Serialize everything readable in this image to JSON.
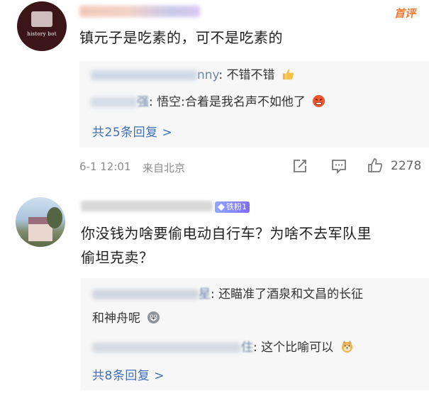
{
  "comment1": {
    "avatar_text": "history bot",
    "badge": "首评",
    "text": "镇元子是吃素的，可不是吃素的",
    "replies": [
      {
        "name_suffix": "nny",
        "text": "不错不错",
        "emoji": "thumbs-up-emoji"
      },
      {
        "name_suffix": "强",
        "text": "悟空:合着是我名声不如他了",
        "emoji": "angry-face-emoji"
      }
    ],
    "more": "共25条回复 >",
    "time": "6-1 12:01",
    "location": "来自北京",
    "likes": "2278"
  },
  "comment2": {
    "fan_badge": "铁粉1",
    "text_line1": "你没钱为啥要偷电动自行车？为啥不去军队里",
    "text_line2": "偷坦克卖？",
    "replies": [
      {
        "name_suffix": "星",
        "text_line1": "还瞄准了酒泉和文昌的长征",
        "text_line2": "和神舟呢",
        "emoji": "husky-face-emoji"
      },
      {
        "name_suffix": "住",
        "text": "这个比喻可以",
        "emoji": "doge-face-emoji"
      }
    ],
    "more": "共8条回复 >"
  }
}
